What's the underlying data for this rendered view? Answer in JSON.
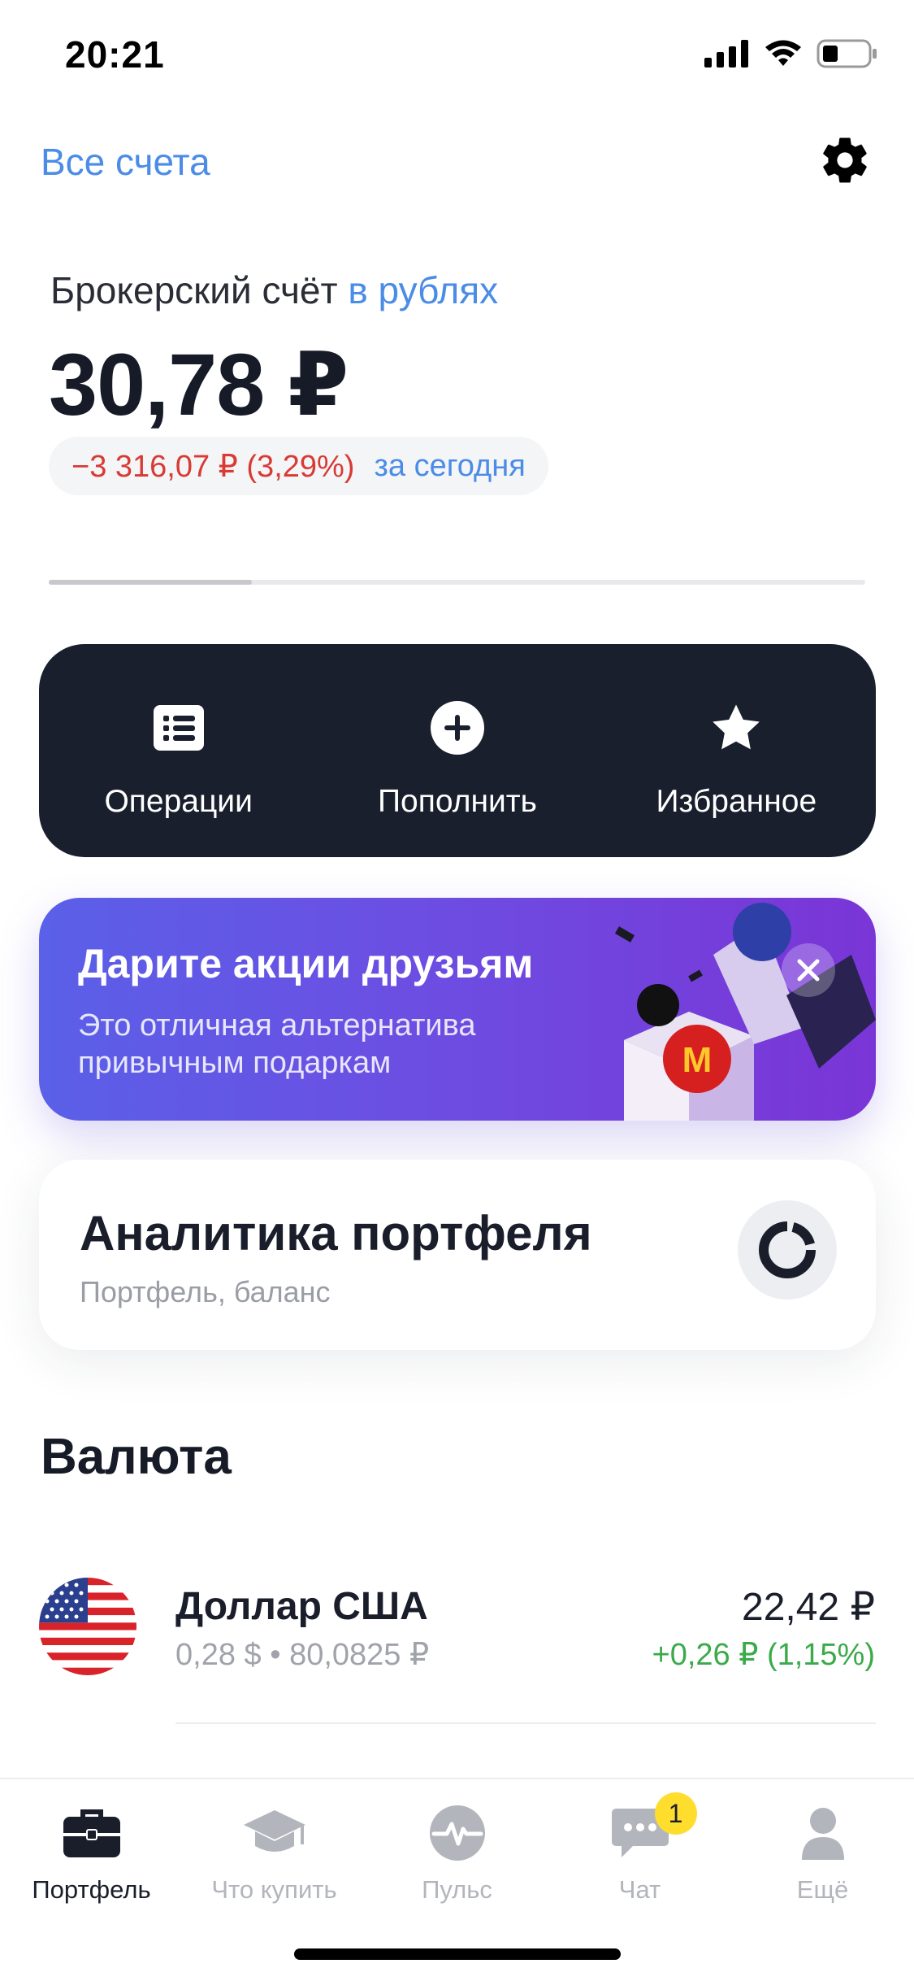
{
  "status_bar": {
    "time": "20:21"
  },
  "header": {
    "all_accounts": "Все счета",
    "settings_icon": "gear-icon"
  },
  "account": {
    "label_prefix": "Брокерский счёт",
    "label_currency": "в рублях",
    "balance": "30,78 ₽",
    "change": "−3 316,07 ₽ (3,29%)",
    "change_period": "за сегодня"
  },
  "quick_actions": [
    {
      "label": "Операции",
      "icon": "list-icon"
    },
    {
      "label": "Пополнить",
      "icon": "plus-circle-icon"
    },
    {
      "label": "Избранное",
      "icon": "star-icon"
    }
  ],
  "promo": {
    "title": "Дарите акции друзьям",
    "text": "Это отличная альтернатива привычным подаркам",
    "close_icon": "close-icon"
  },
  "analytics": {
    "title": "Аналитика портфеля",
    "subtitle": "Портфель, баланс",
    "icon": "donut-chart-icon"
  },
  "currency_section": {
    "title": "Валюта",
    "items": [
      {
        "name": "Доллар США",
        "meta": "0,28 $ • 80,0825 ₽",
        "value": "22,42 ₽",
        "change": "+0,26 ₽ (1,15%)",
        "icon": "us-flag-icon"
      }
    ]
  },
  "tab_bar": {
    "items": [
      {
        "label": "Портфель",
        "icon": "briefcase-icon",
        "active": true
      },
      {
        "label": "Что купить",
        "icon": "graduation-cap-icon",
        "active": false
      },
      {
        "label": "Пульс",
        "icon": "pulse-icon",
        "active": false
      },
      {
        "label": "Чат",
        "icon": "chat-icon",
        "active": false,
        "badge": "1"
      },
      {
        "label": "Ещё",
        "icon": "profile-icon",
        "active": false
      }
    ]
  },
  "colors": {
    "accent": "#4b8ce6",
    "negative": "#d83a34",
    "positive": "#3aaa4a",
    "dark_panel": "#1a1f2e",
    "badge": "#ffdd2d"
  }
}
